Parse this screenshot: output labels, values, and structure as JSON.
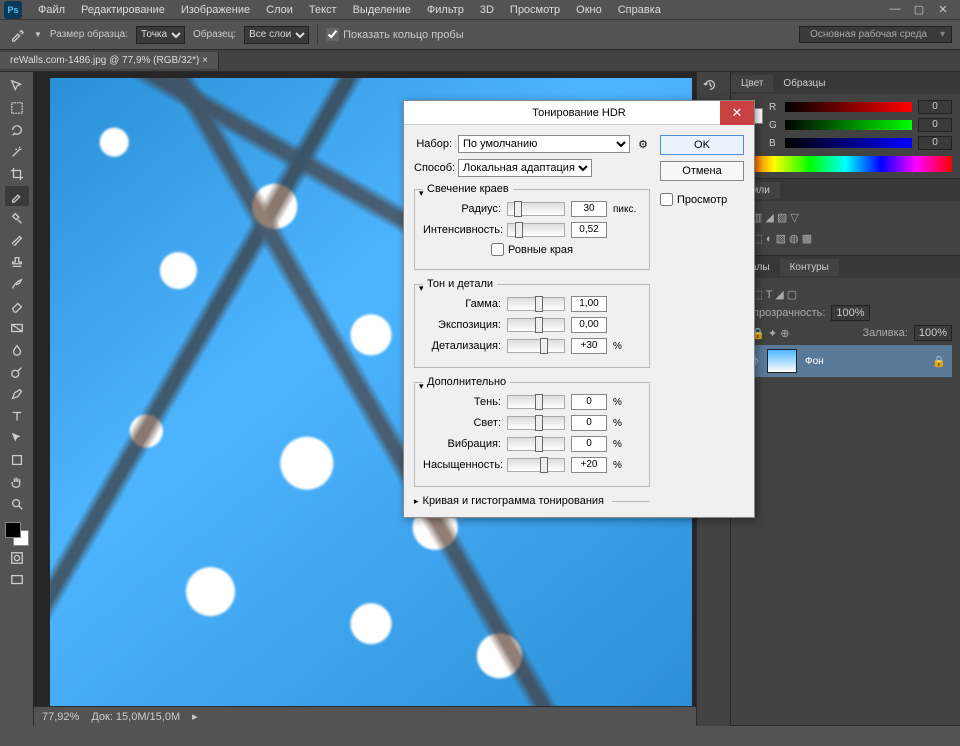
{
  "menubar": {
    "items": [
      "Файл",
      "Редактирование",
      "Изображение",
      "Слои",
      "Текст",
      "Выделение",
      "Фильтр",
      "3D",
      "Просмотр",
      "Окно",
      "Справка"
    ]
  },
  "optbar": {
    "sample_size_label": "Размер образца:",
    "sample_size_value": "Точка",
    "sample_label": "Образец:",
    "sample_value": "Все слои",
    "show_ring": "Показать кольцо пробы",
    "workspace": "Основная рабочая среда"
  },
  "doctab": {
    "title": "reWalls.com-1486.jpg @ 77,9% (RGB/32*) ×"
  },
  "status": {
    "zoom": "77,92%",
    "doc": "Док: 15,0M/15,0M"
  },
  "color_panel": {
    "tabs": [
      "Цвет",
      "Образцы"
    ],
    "r": "0",
    "g": "0",
    "b": "0",
    "channels": [
      "R",
      "G",
      "B"
    ]
  },
  "styles_panel": {
    "tab": "Стили"
  },
  "layers_panel": {
    "tabs": [
      "…алы",
      "Контуры"
    ],
    "opacity_label": "Непрозрачность:",
    "opacity": "100%",
    "fill_label": "Заливка:",
    "fill": "100%",
    "layer_name": "Фон"
  },
  "dialog": {
    "title": "Тонирование HDR",
    "preset_label": "Набор:",
    "preset": "По умолчанию",
    "method_label": "Способ:",
    "method": "Локальная адаптация",
    "ok": "OK",
    "cancel": "Отмена",
    "preview": "Просмотр",
    "edge_glow": {
      "legend": "Свечение краев",
      "radius_label": "Радиус:",
      "radius": "30",
      "radius_unit": "пикс.",
      "strength_label": "Интенсивность:",
      "strength": "0,52",
      "smooth": "Ровные края"
    },
    "tone": {
      "legend": "Тон и детали",
      "gamma_label": "Гамма:",
      "gamma": "1,00",
      "exposure_label": "Экспозиция:",
      "exposure": "0,00",
      "detail_label": "Детализация:",
      "detail": "+30",
      "unit": "%"
    },
    "advanced": {
      "legend": "Дополнительно",
      "shadow_label": "Тень:",
      "shadow": "0",
      "highlight_label": "Свет:",
      "highlight": "0",
      "vibrance_label": "Вибрация:",
      "vibrance": "0",
      "saturation_label": "Насыщенность:",
      "saturation": "+20",
      "unit": "%"
    },
    "curve": "Кривая и гистограмма тонирования"
  }
}
